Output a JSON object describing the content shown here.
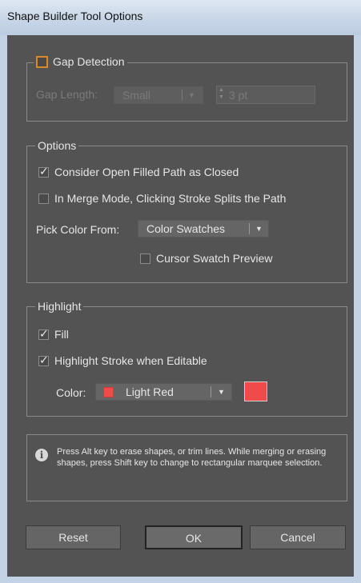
{
  "window": {
    "title": "Shape Builder Tool Options"
  },
  "gap": {
    "legend": "Gap Detection",
    "enabled": false,
    "length_label": "Gap Length:",
    "length_value": "Small",
    "custom_value": "3 pt"
  },
  "options": {
    "legend": "Options",
    "consider_open_label": "Consider Open Filled Path as Closed",
    "consider_open_checked": true,
    "merge_mode_label": "In Merge Mode, Clicking Stroke Splits the Path",
    "merge_mode_checked": false,
    "pick_color_label": "Pick Color From:",
    "pick_color_value": "Color Swatches",
    "cursor_preview_label": "Cursor Swatch Preview",
    "cursor_preview_checked": false
  },
  "highlight": {
    "legend": "Highlight",
    "fill_label": "Fill",
    "fill_checked": true,
    "stroke_label": "Highlight Stroke when Editable",
    "stroke_checked": true,
    "color_label": "Color:",
    "color_value": "Light Red",
    "color_hex": "#f04b4b"
  },
  "info": {
    "text": "Press Alt key to erase shapes, or trim lines. While merging or erasing shapes, press Shift key to change to rectangular marquee selection."
  },
  "buttons": {
    "reset": "Reset",
    "ok": "OK",
    "cancel": "Cancel"
  }
}
